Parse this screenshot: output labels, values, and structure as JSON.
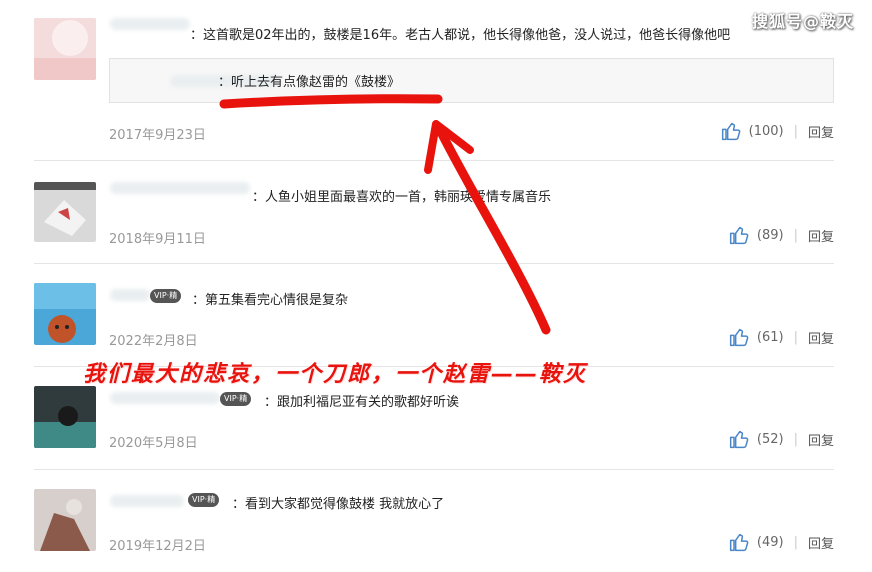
{
  "watermark": "搜狐号@鞍灭",
  "comments": [
    {
      "text": "：这首歌是02年出的，鼓楼是16年。老古人都说，他长得像他爸，没人说过，他爸长得像他吧",
      "quote": "：听上去有点像赵雷的《鼓楼》",
      "date": "2017年9月23日",
      "likes": "(100)",
      "reply": "回复"
    },
    {
      "text": "：人鱼小姐里面最喜欢的一首，韩丽瑛爱情专属音乐",
      "date": "2018年9月11日",
      "likes": "(89)",
      "reply": "回复"
    },
    {
      "vip": "VIP·精",
      "text": "：第五集看完心情很是复杂",
      "date": "2022年2月8日",
      "likes": "(61)",
      "reply": "回复"
    },
    {
      "vip": "VIP·精",
      "text": "：跟加利福尼亚有关的歌都好听诶",
      "date": "2020年5月8日",
      "likes": "(52)",
      "reply": "回复"
    },
    {
      "vip": "VIP·精",
      "text": "：看到大家都觉得像鼓楼 我就放心了",
      "date": "2019年12月2日",
      "likes": "(49)",
      "reply": "回复"
    }
  ],
  "overlay_caption": "我们最大的悲哀，一个刀郎，一个赵雷——鞍灭",
  "colors": {
    "annotation_red": "#e8130d",
    "like_blue": "#4a86c8",
    "date_gray": "#999999"
  }
}
